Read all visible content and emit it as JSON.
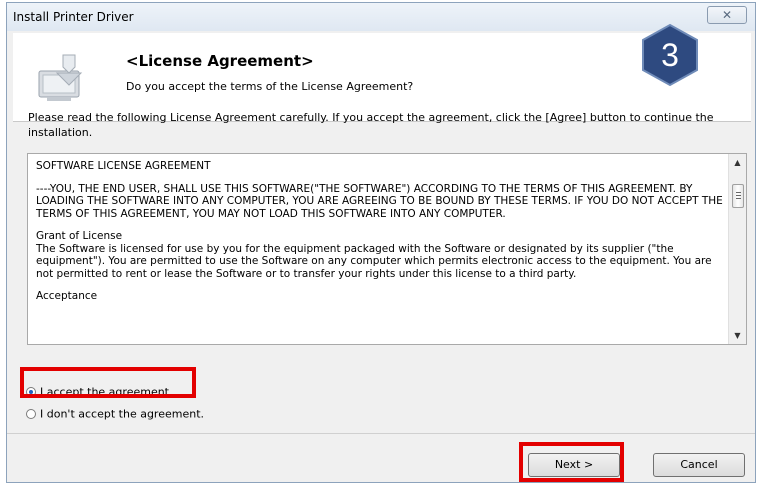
{
  "window": {
    "title": "Install Printer Driver",
    "close_glyph": "✕"
  },
  "header": {
    "title": "<License Agreement>",
    "subtitle": "Do you accept the terms of the License Agreement?",
    "step_number": "3",
    "badge_color": "#2e4a80",
    "icon": "installer-computer-icon"
  },
  "intro_text": "Please read the following License Agreement carefully. If you accept the agreement, click the [Agree] button to continue the installation.",
  "license": {
    "heading": "SOFTWARE LICENSE AGREEMENT",
    "para1": "----YOU, THE END USER, SHALL USE THIS SOFTWARE(\"THE SOFTWARE\") ACCORDING TO THE TERMS OF THIS AGREEMENT. BY LOADING THE SOFTWARE INTO ANY COMPUTER, YOU ARE AGREEING TO BE BOUND BY THESE TERMS. IF YOU DO NOT ACCEPT THE TERMS OF THIS AGREEMENT, YOU MAY NOT LOAD THIS SOFTWARE INTO ANY COMPUTER.",
    "grant_title": "Grant of License",
    "grant_text": "The Software is licensed for use by you for the equipment packaged with the Software or designated by its supplier (\"the equipment\"). You are permitted to use the Software on any computer which permits electronic access to the equipment. You are not permitted to rent or lease the Software or to transfer your rights under this license to a third party.",
    "acceptance_title": "Acceptance"
  },
  "options": {
    "accept_label": "I accept the agreement.",
    "decline_label": "I don't accept the agreement.",
    "selected": "accept"
  },
  "buttons": {
    "next_label": "Next >",
    "cancel_label": "Cancel"
  },
  "highlight_color": "#e30000"
}
